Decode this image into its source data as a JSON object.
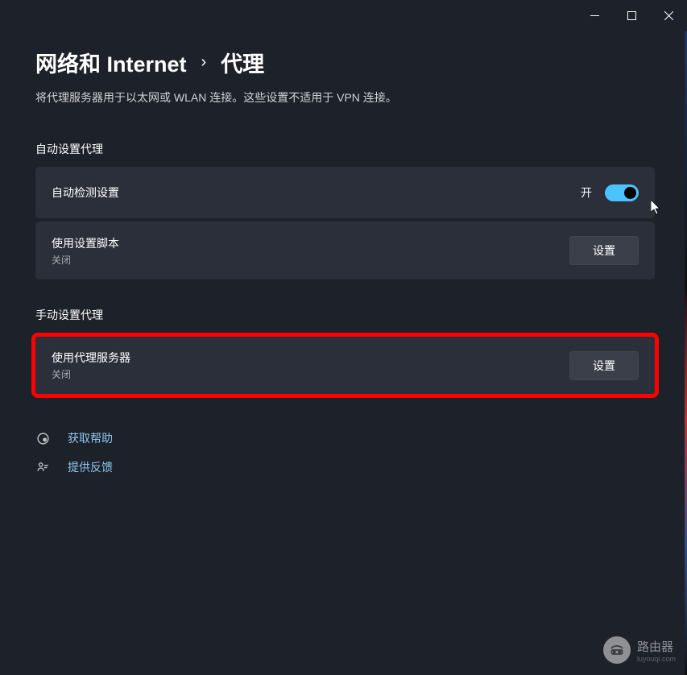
{
  "breadcrumb": {
    "parent": "网络和 Internet",
    "current": "代理"
  },
  "description": "将代理服务器用于以太网或 WLAN 连接。这些设置不适用于 VPN 连接。",
  "sections": {
    "auto": {
      "title": "自动设置代理",
      "detect": {
        "label": "自动检测设置",
        "toggle_state": "开",
        "enabled": true
      },
      "script": {
        "label": "使用设置脚本",
        "status": "关闭",
        "button": "设置"
      }
    },
    "manual": {
      "title": "手动设置代理",
      "proxy": {
        "label": "使用代理服务器",
        "status": "关闭",
        "button": "设置"
      }
    }
  },
  "help": {
    "get_help": "获取帮助",
    "feedback": "提供反馈"
  },
  "watermark": {
    "title": "路由器",
    "url": "luyouqi.com"
  }
}
